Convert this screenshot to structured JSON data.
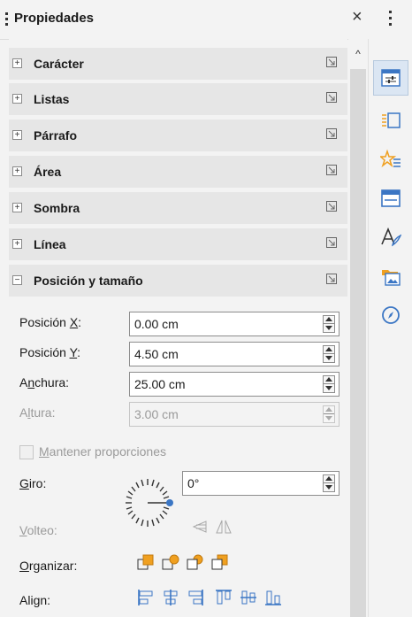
{
  "panel": {
    "title": "Propiedades",
    "close_glyph": "×"
  },
  "sections": [
    {
      "label": "Carácter",
      "expander": "+"
    },
    {
      "label": "Listas",
      "expander": "+"
    },
    {
      "label": "Párrafo",
      "expander": "+"
    },
    {
      "label": "Área",
      "expander": "+"
    },
    {
      "label": "Sombra",
      "expander": "+"
    },
    {
      "label": "Línea",
      "expander": "+"
    },
    {
      "label": "Posición y tamaño",
      "expander": "−"
    }
  ],
  "position_size": {
    "pos_x": {
      "label_pre": "Posición ",
      "label_u": "X",
      "label_post": ":",
      "value": "0.00 cm"
    },
    "pos_y": {
      "label_pre": "Posición ",
      "label_u": "Y",
      "label_post": ":",
      "value": "4.50 cm"
    },
    "width": {
      "label_pre": "A",
      "label_u": "n",
      "label_post": "chura:",
      "value": "25.00 cm"
    },
    "height": {
      "label_pre": "A",
      "label_u": "l",
      "label_post": "tura:",
      "value": "3.00 cm"
    },
    "keep_ratio": {
      "label_u": "M",
      "label_post": "antener proporciones",
      "checked": false
    },
    "rotation": {
      "label_u": "G",
      "label_post": "iro:",
      "value": "0°"
    },
    "flip": {
      "label_u": "V",
      "label_post": "olteo:"
    },
    "arrange": {
      "label_u": "O",
      "label_post": "rganizar:"
    },
    "align": {
      "label_pre": "Ali",
      "label_u": "g",
      "label_post": "n:"
    }
  },
  "sidebar_tabs": [
    "properties-icon",
    "styles-icon",
    "gallery-icon",
    "page-icon",
    "character-style-icon",
    "image-folder-icon",
    "navigator-icon"
  ],
  "colors": {
    "accent": "#3b76c4",
    "icon_orange": "#f0a020",
    "header_bg": "#e6e6e6"
  }
}
